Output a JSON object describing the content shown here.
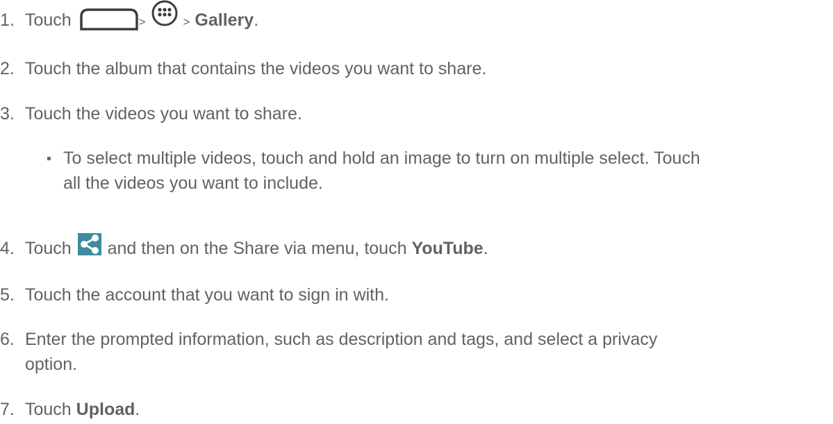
{
  "steps": [
    {
      "num": "1.",
      "t1": "Touch",
      "sep1": ">",
      "sep2": ">",
      "bold": "Gallery",
      "end": "."
    },
    {
      "num": "2.",
      "text": "Touch the album that contains the videos you want to share."
    },
    {
      "num": "3.",
      "text": "Touch the videos you want to share."
    },
    {
      "num": "4.",
      "t1": "Touch",
      "t2": "and then on the Share via menu, touch",
      "bold": "YouTube",
      "end": "."
    },
    {
      "num": "5.",
      "text": "Touch the account that you want to sign in with."
    },
    {
      "num": "6.",
      "line1": "Enter the prompted information, such as description and tags, and select a privacy",
      "line2": "option."
    },
    {
      "num": "7.",
      "t1": "Touch",
      "bold": "Upload",
      "end": "."
    }
  ],
  "sub_bullet": {
    "line1": "To select multiple videos, touch and hold an image to turn on multiple select. Touch",
    "line2": "all the videos you want to include."
  },
  "icons": {
    "home": "home-icon",
    "apps": "apps-icon",
    "share": "share-icon"
  },
  "colors": {
    "text": "#5f6266",
    "icon_stroke": "#3c3c3c",
    "share_bg": "#3c8c9c"
  }
}
